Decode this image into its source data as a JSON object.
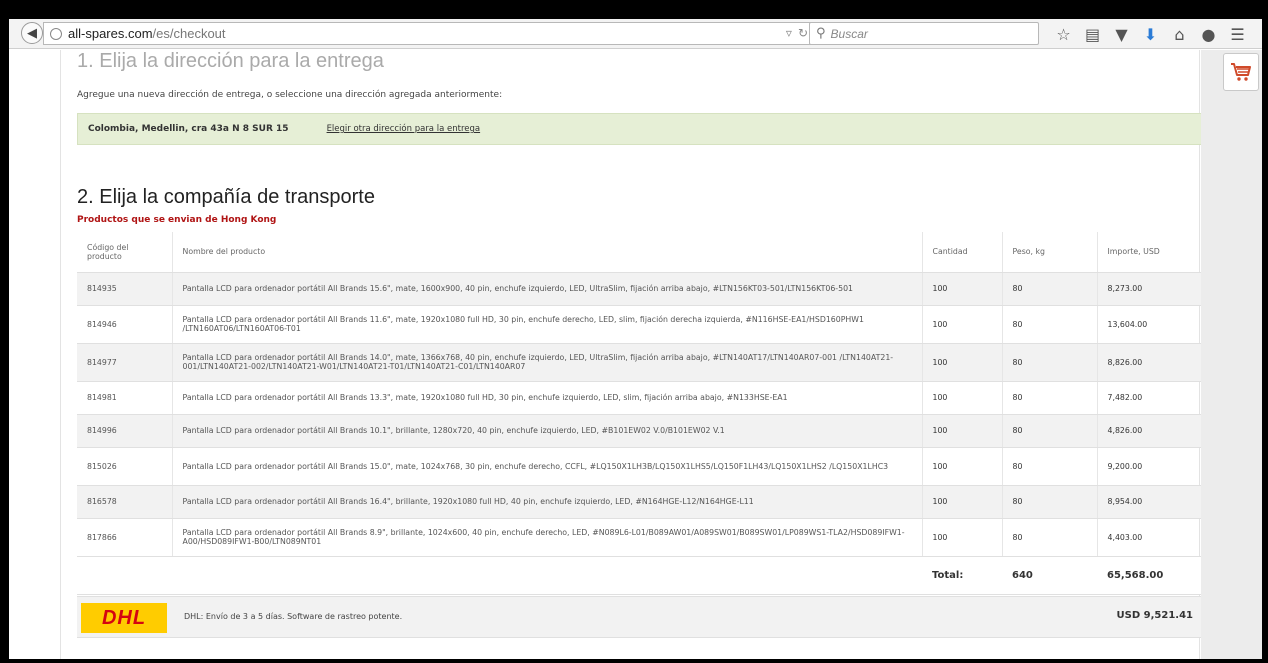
{
  "browser": {
    "url_host": "all-spares.com",
    "url_path": "/es/checkout",
    "search_placeholder": "Buscar"
  },
  "step1": {
    "title": "1. Elija la dirección para la entrega",
    "intro": "Agregue una nueva dirección de entrega, o seleccione una dirección agregada anteriormente:",
    "address": "Colombia, Medellin, cra 43a N 8 SUR 15",
    "change_link": "Elegir otra dirección para la entrega"
  },
  "step2": {
    "title": "2. Elija la compañía de transporte",
    "origin_label": "Productos que se envian de Hong Kong"
  },
  "table": {
    "headers": {
      "code": "Código del producto",
      "name": "Nombre del producto",
      "qty": "Cantidad",
      "weight": "Peso, kg",
      "amount": "Importe, USD"
    },
    "rows": [
      {
        "code": "814935",
        "name": "Pantalla LCD para ordenador portátil All Brands 15.6\", mate, 1600x900, 40 pin, enchufe izquierdo, LED, UltraSlim, fijación arriba abajo, #LTN156KT03-501/LTN156KT06-501",
        "qty": "100",
        "weight": "80",
        "amount": "8,273.00"
      },
      {
        "code": "814946",
        "name": "Pantalla LCD para ordenador portátil All Brands 11.6\", mate, 1920x1080 full HD, 30 pin, enchufe derecho, LED, slim, fijación derecha izquierda, #N116HSE-EA1/HSD160PHW1 /LTN160AT06/LTN160AT06-T01",
        "qty": "100",
        "weight": "80",
        "amount": "13,604.00"
      },
      {
        "code": "814977",
        "name": "Pantalla LCD para ordenador portátil All Brands 14.0\", mate, 1366x768, 40 pin, enchufe izquierdo, LED, UltraSlim, fijación arriba abajo, #LTN140AT17/LTN140AR07-001 /LTN140AT21-001/LTN140AT21-002/LTN140AT21-W01/LTN140AT21-T01/LTN140AT21-C01/LTN140AR07",
        "qty": "100",
        "weight": "80",
        "amount": "8,826.00"
      },
      {
        "code": "814981",
        "name": "Pantalla LCD para ordenador portátil All Brands 13.3\", mate, 1920x1080 full HD, 30 pin, enchufe izquierdo, LED, slim, fijación arriba abajo, #N133HSE-EA1",
        "qty": "100",
        "weight": "80",
        "amount": "7,482.00"
      },
      {
        "code": "814996",
        "name": "Pantalla LCD para ordenador portátil All Brands 10.1\", brillante, 1280x720, 40 pin, enchufe izquierdo, LED, #B101EW02 V.0/B101EW02 V.1",
        "qty": "100",
        "weight": "80",
        "amount": "4,826.00"
      },
      {
        "code": "815026",
        "name": "Pantalla LCD para ordenador portátil All Brands 15.0\", mate, 1024x768, 30 pin, enchufe derecho, CCFL, #LQ150X1LH3B/LQ150X1LHS5/LQ150F1LH43/LQ150X1LHS2 /LQ150X1LHC3",
        "qty": "100",
        "weight": "80",
        "amount": "9,200.00"
      },
      {
        "code": "816578",
        "name": "Pantalla LCD para ordenador portátil All Brands 16.4\", brillante, 1920x1080 full HD, 40 pin, enchufe izquierdo, LED, #N164HGE-L12/N164HGE-L11",
        "qty": "100",
        "weight": "80",
        "amount": "8,954.00"
      },
      {
        "code": "817866",
        "name": "Pantalla LCD para ordenador portátil All Brands 8.9\", brillante, 1024x600, 40 pin, enchufe derecho, LED, #N089L6-L01/B089AW01/A089SW01/B089SW01/LP089WS1-TLA2/HSD089IFW1-A00/HSD089IFW1-B00/LTN089NT01",
        "qty": "100",
        "weight": "80",
        "amount": "4,403.00"
      }
    ],
    "total": {
      "label": "Total:",
      "qty": "640",
      "amount": "65,568.00"
    }
  },
  "shipping": {
    "logo_text": "DHL",
    "description": "DHL: Envío de 3 a 5 días. Software de rastreo potente.",
    "price": "USD 9,521.41"
  }
}
